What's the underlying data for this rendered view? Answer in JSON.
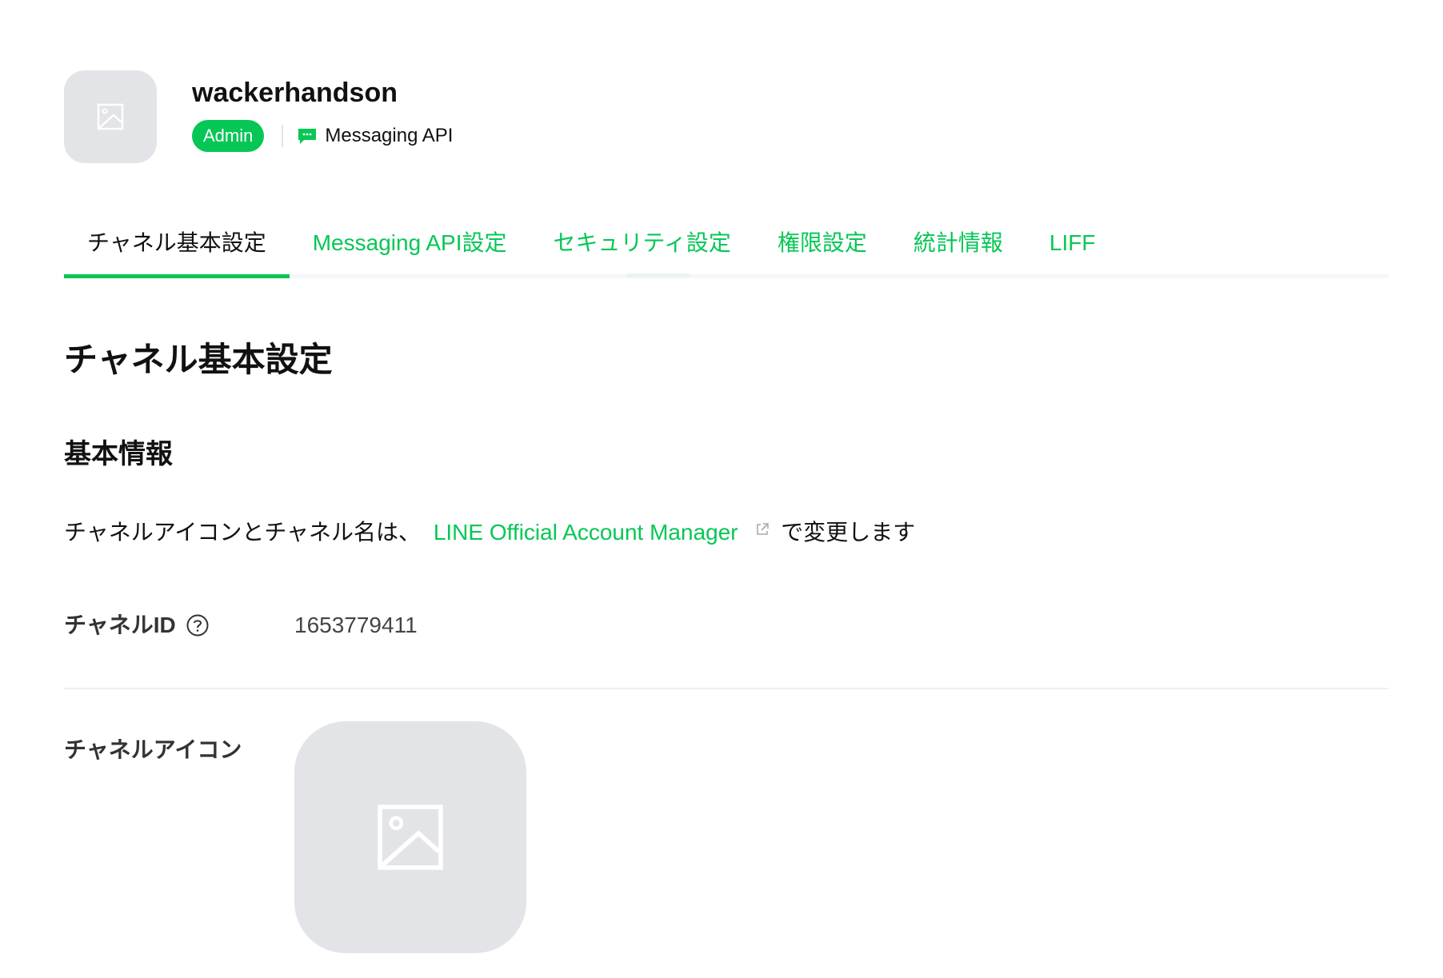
{
  "header": {
    "channel_name": "wackerhandson",
    "role_badge": "Admin",
    "channel_type": "Messaging API",
    "icons": {
      "avatar": "image-placeholder-icon",
      "type": "chat-bubble-icon"
    }
  },
  "tabs": [
    {
      "label": "チャネル基本設定",
      "active": true
    },
    {
      "label": "Messaging API設定",
      "active": false
    },
    {
      "label": "セキュリティ設定",
      "active": false
    },
    {
      "label": "権限設定",
      "active": false
    },
    {
      "label": "統計情報",
      "active": false
    },
    {
      "label": "LIFF",
      "active": false
    }
  ],
  "main": {
    "page_title": "チャネル基本設定",
    "section_title": "基本情報",
    "description": {
      "prefix": "チャネルアイコンとチャネル名は、",
      "link_text": "LINE Official Account Manager",
      "suffix": "で変更します"
    },
    "fields": {
      "channel_id_label": "チャネルID",
      "channel_id_value": "1653779411",
      "channel_icon_label": "チャネルアイコン"
    }
  },
  "colors": {
    "accent": "#06c755",
    "placeholder_bg": "#e3e4e8",
    "text": "#111111"
  }
}
